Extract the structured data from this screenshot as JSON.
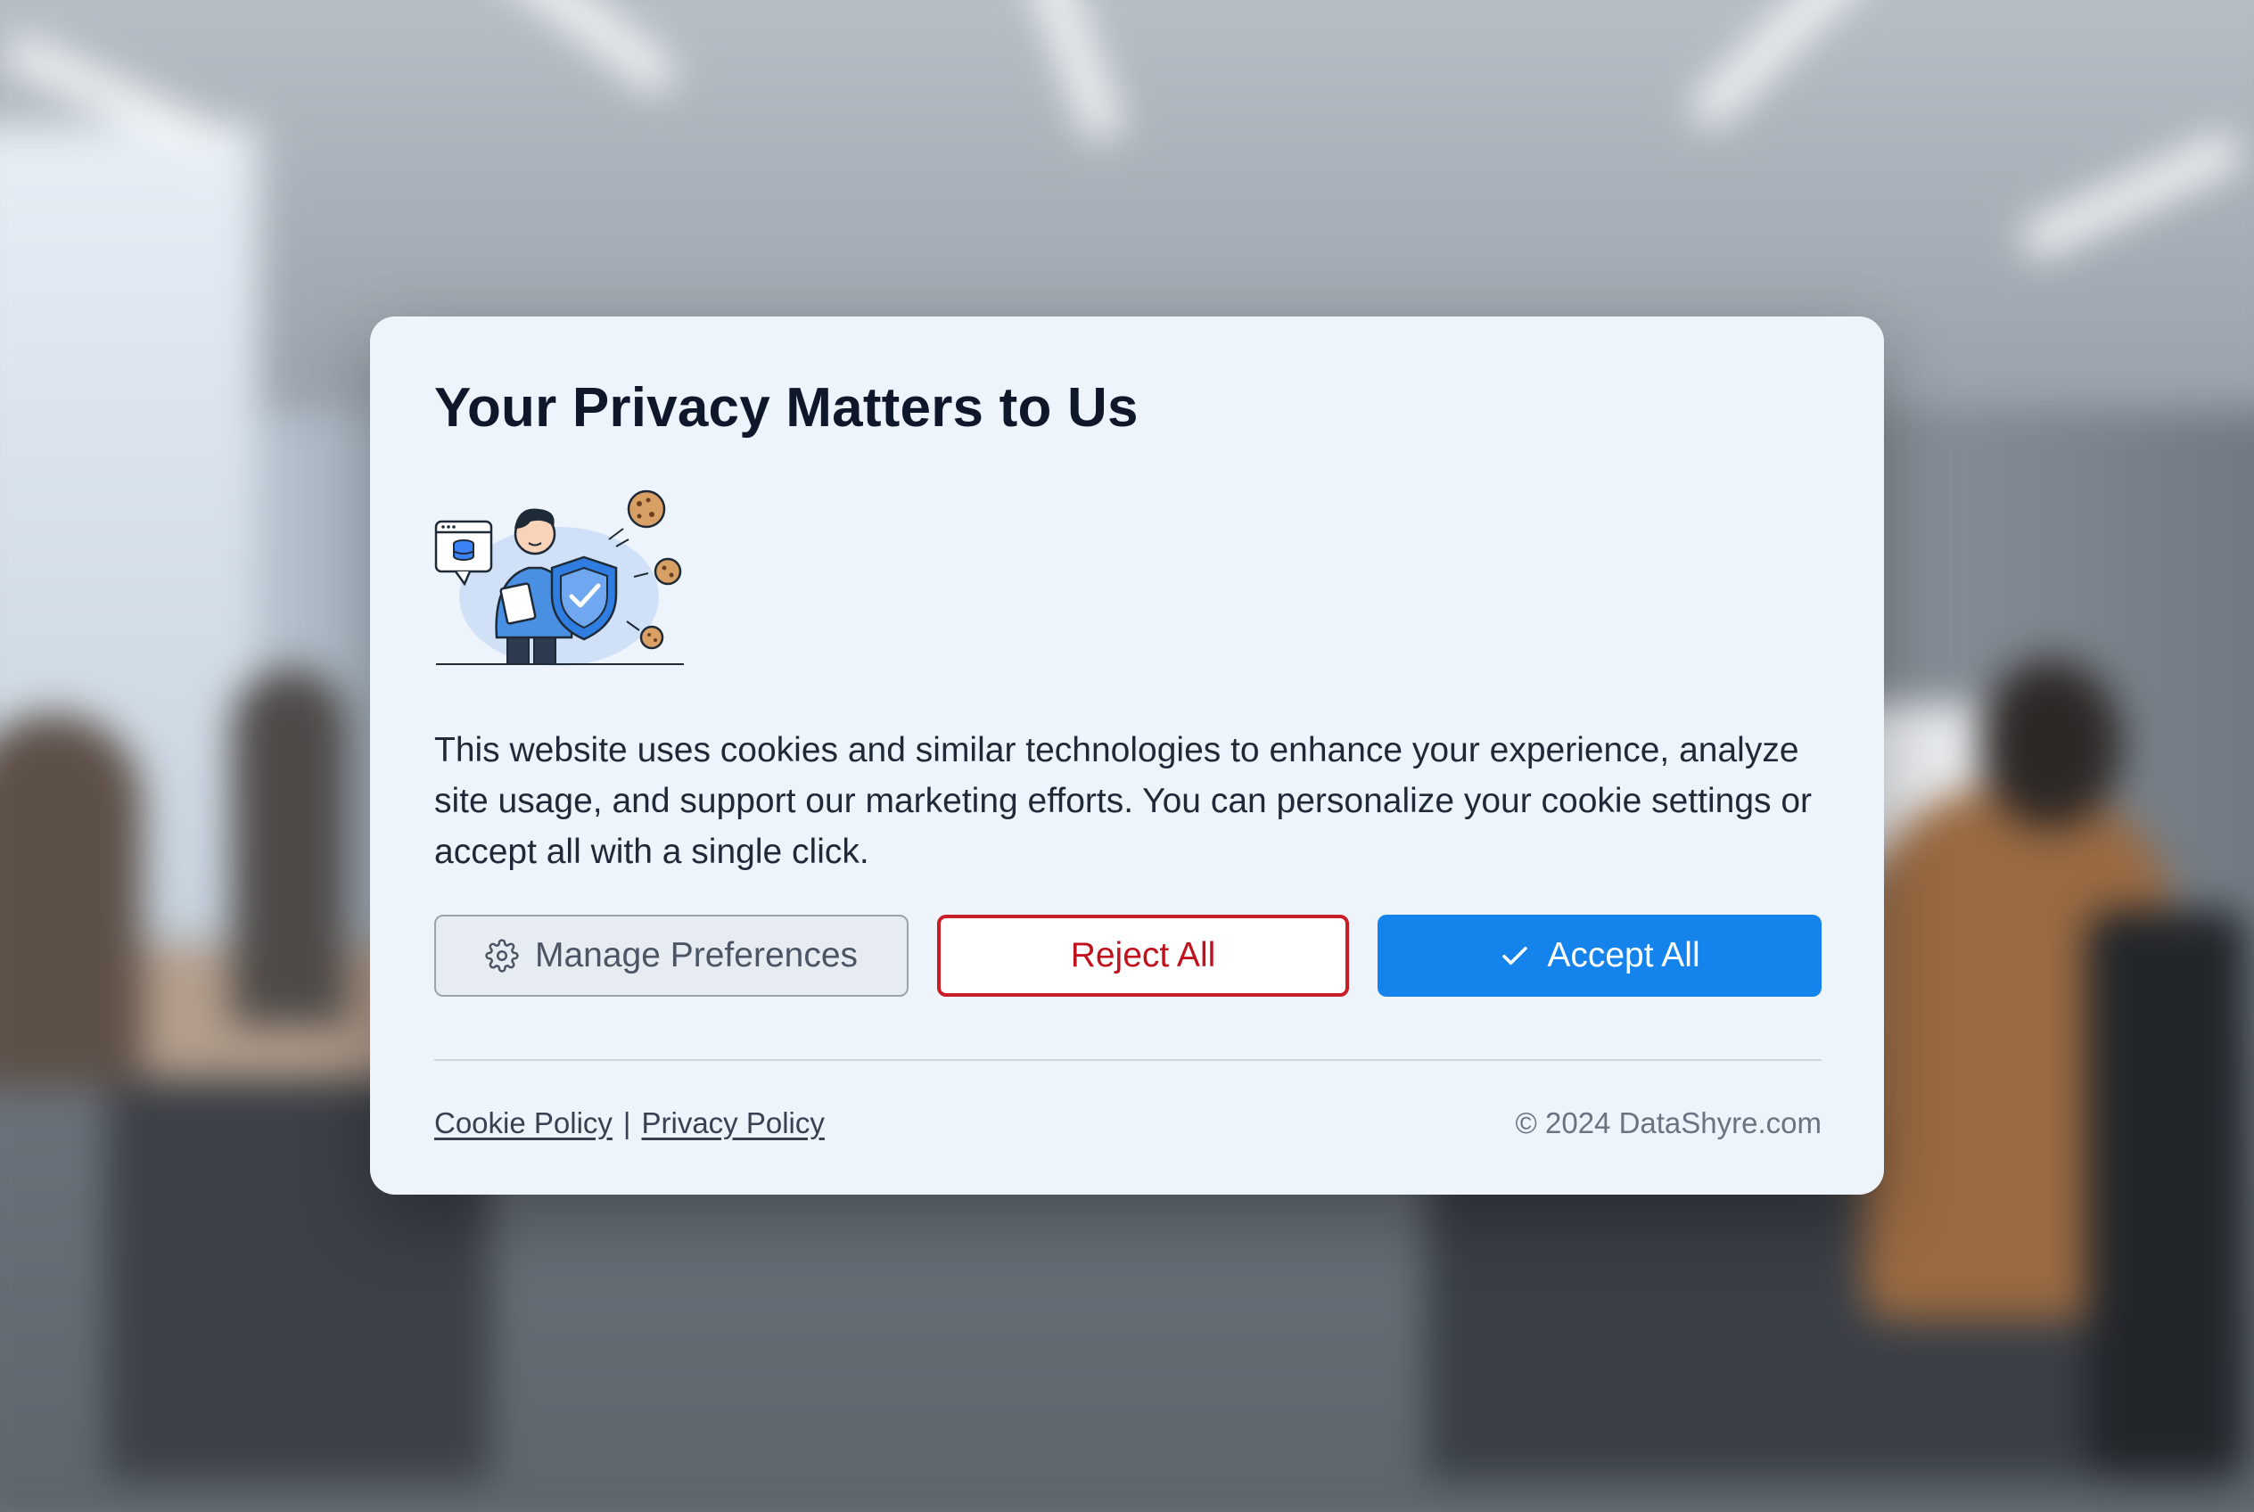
{
  "dialog": {
    "title": "Your Privacy Matters to Us",
    "illustration_icon": "privacy-shield-cookies-illustration",
    "body": "This website uses cookies and similar technologies to enhance your experience, analyze site usage, and support our marketing efforts. You can personalize your cookie settings or accept all with a single click."
  },
  "buttons": {
    "manage": {
      "label": "Manage Preferences",
      "icon": "gear-icon"
    },
    "reject": {
      "label": "Reject All"
    },
    "accept": {
      "label": "Accept All",
      "icon": "check-icon"
    }
  },
  "footer": {
    "cookie_policy": "Cookie Policy",
    "separator": "|",
    "privacy_policy": "Privacy Policy",
    "copyright": "© 2024 DataShyre.com"
  },
  "colors": {
    "dialog_bg": "#eef4fc",
    "accept_bg": "#1484ec",
    "reject_border": "#c81e26",
    "manage_bg": "#e7ecf3"
  }
}
